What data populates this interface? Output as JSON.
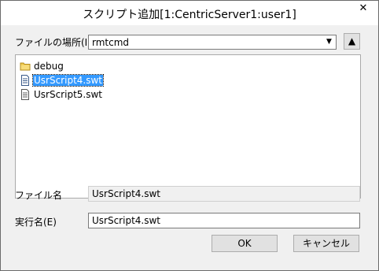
{
  "window": {
    "title": "スクリプト追加[1:CentricServer1:user1]",
    "close_glyph": "✕"
  },
  "look_in": {
    "label": "ファイルの場所(I)",
    "value": "rmtcmd",
    "dropdown_glyph": "▼",
    "up_glyph": "▲"
  },
  "file_list": {
    "items": [
      {
        "name": "debug",
        "type": "folder",
        "selected": false
      },
      {
        "name": "UsrScript4.swt",
        "type": "file",
        "selected": true
      },
      {
        "name": "UsrScript5.swt",
        "type": "file",
        "selected": false
      }
    ]
  },
  "filename": {
    "label": "ファイル名",
    "value": "UsrScript4.swt"
  },
  "exec_name": {
    "label": "実行名(E)",
    "value": "UsrScript4.swt"
  },
  "buttons": {
    "ok_label": "OK",
    "cancel_label": "キャンセル"
  },
  "colors": {
    "selection": "#3399ff",
    "dialog_bg": "#f0f0f0",
    "folder": "#f0c94a"
  }
}
